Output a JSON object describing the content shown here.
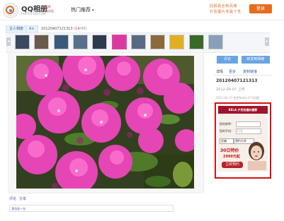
{
  "header": {
    "app_title": "QQ相册",
    "app_subtitle": "PHOTO.QQ.COM",
    "slogan_1": "托盘影",
    "slogan_2": "一键封盘",
    "hot_menu_label": "热门推荐",
    "promo_line_1": "回顾看全新风格",
    "promo_line_2": "打造图片专属个性",
    "register_label": "登录"
  },
  "breadcrumb": {
    "owner": "主人相册",
    "album": "A+",
    "current_name": "20120407121313",
    "current_index": "(14",
    "current_total": "/45)"
  },
  "thumbnails": {
    "colors": [
      "#3a4a5e",
      "#6a5a4a",
      "#3b5a7a",
      "#5a6f8a",
      "#2e3a4e",
      "#d83aa0",
      "#5a6a84",
      "#8a6a3a",
      "#e0b020",
      "#3a6a2a",
      "#8aa0b8"
    ],
    "active_index": 5
  },
  "photo": {
    "subject": "pink-azalea-flowers"
  },
  "actions": {
    "comment_label": "评论",
    "share_label": "转发到相册",
    "detail_label": "详情",
    "more_label": "更多",
    "copy_label": "复制链接"
  },
  "info": {
    "photo_name": "20120407121313",
    "upload_time": "2012-04-07 上传",
    "camera_info": "2012-04-07 使用Nokia E71拍摄"
  },
  "ad": {
    "brand": "KELA 夕克拉婚纱摄影",
    "name_label": "您的称呼：",
    "phone_label": "您的手机：",
    "phone_placeholder": "行业",
    "select_1": "定编",
    "select_2": "预约分享",
    "offer_1": "30日特价",
    "offer_2": "2999元起",
    "signup_label": "立即预约"
  },
  "bottom": {
    "comment_label": "评论",
    "share_label": "分享",
    "comment_placeholder": "我也说一句"
  }
}
